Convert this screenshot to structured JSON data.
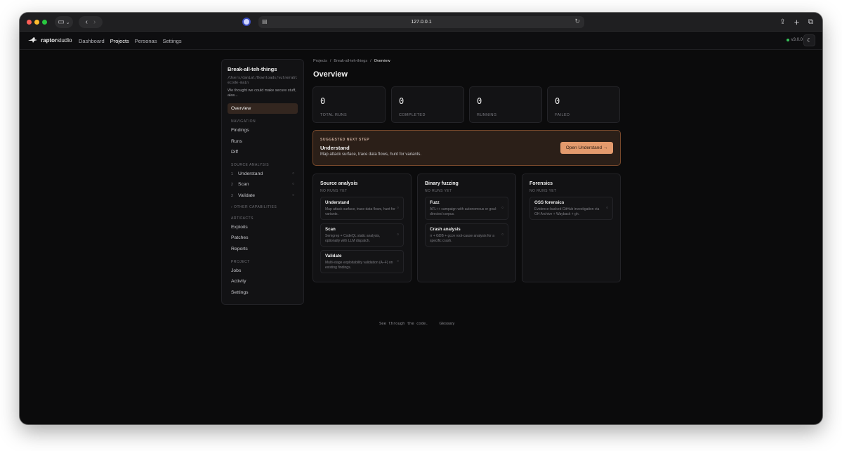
{
  "browser": {
    "url": "127.0.0.1"
  },
  "app": {
    "brand_prefix": "raptor",
    "brand_suffix": "studio",
    "nav": [
      "Dashboard",
      "Projects",
      "Personas",
      "Settings"
    ],
    "active_nav": "Projects",
    "version": "v3.0.0"
  },
  "project": {
    "name": "Break-all-teh-things",
    "path": "/Users/danial/Downloads/vulnerablecode-main",
    "description": "We thought we could make secure stuff, alas..."
  },
  "sidebar": {
    "overview": "Overview",
    "navigation_label": "NAVIGATION",
    "navigation": [
      "Findings",
      "Runs",
      "Diff"
    ],
    "source_label": "SOURCE ANALYSIS",
    "source_steps": [
      {
        "num": "1",
        "label": "Understand",
        "status": "○"
      },
      {
        "num": "2",
        "label": "Scan",
        "status": "○"
      },
      {
        "num": "3",
        "label": "Validate",
        "status": "○"
      }
    ],
    "other_label": "› OTHER CAPABILITIES",
    "artifacts_label": "ARTIFACTS",
    "artifacts": [
      "Exploits",
      "Patches",
      "Reports"
    ],
    "project_label": "PROJECT",
    "project_items": [
      "Jobs",
      "Activity",
      "Settings"
    ]
  },
  "breadcrumb": [
    "Projects",
    "Break-all-teh-things",
    "Overview"
  ],
  "page_title": "Overview",
  "stats": [
    {
      "value": "0",
      "label": "TOTAL RUNS"
    },
    {
      "value": "0",
      "label": "COMPLETED"
    },
    {
      "value": "0",
      "label": "RUNNING"
    },
    {
      "value": "0",
      "label": "FAILED"
    }
  ],
  "suggestion": {
    "kicker": "SUGGESTED NEXT STEP",
    "title": "Understand",
    "description": "Map attack surface, trace data flows, hunt for variants.",
    "button": "Open Understand →"
  },
  "panels": [
    {
      "title": "Source analysis",
      "subtitle": "NO RUNS YET",
      "items": [
        {
          "name": "Understand",
          "desc": "Map attack surface, trace data flows, hunt for variants.",
          "status": "○"
        },
        {
          "name": "Scan",
          "desc": "Semgrep + CodeQL static analysis, optionally with LLM dispatch.",
          "status": "○"
        },
        {
          "name": "Validate",
          "desc": "Multi-stage exploitability validation (A–F) on existing findings.",
          "status": "○"
        }
      ]
    },
    {
      "title": "Binary fuzzing",
      "subtitle": "NO RUNS YET",
      "items": [
        {
          "name": "Fuzz",
          "desc": "AFL++ campaign with autonomous or goal-directed corpus.",
          "status": "○"
        },
        {
          "name": "Crash analysis",
          "desc": "rr + GDB + gcov root-cause analysis for a specific crash.",
          "status": "○"
        }
      ]
    },
    {
      "title": "Forensics",
      "subtitle": "NO RUNS YET",
      "items": [
        {
          "name": "OSS forensics",
          "desc": "Evidence-backed GitHub investigation via GH Archive + Wayback + gh.",
          "status": "○"
        }
      ]
    }
  ],
  "footer": {
    "tagline": "See through the code.",
    "link": "Glossary"
  }
}
